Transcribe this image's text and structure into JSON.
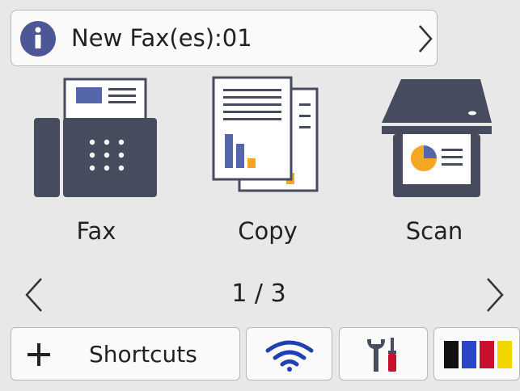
{
  "notification": {
    "message": "New Fax(es):01",
    "icon": "info-icon",
    "chevron": "chevron-right-icon"
  },
  "tiles": [
    {
      "id": "fax",
      "label": "Fax",
      "icon": "fax-machine-icon"
    },
    {
      "id": "copy",
      "label": "Copy",
      "icon": "copy-documents-icon"
    },
    {
      "id": "scan",
      "label": "Scan",
      "icon": "scanner-icon"
    }
  ],
  "pager": {
    "indicator": "1 / 3",
    "prev_icon": "chevron-left-icon",
    "next_icon": "chevron-right-icon"
  },
  "bottom_bar": {
    "shortcuts_label": "Shortcuts",
    "shortcuts_icon": "plus-icon",
    "wifi_icon": "wifi-icon",
    "settings_icon": "settings-tools-icon",
    "ink_icon": "ink-levels-icon"
  },
  "colors": {
    "background": "#e8e8e8",
    "icon_dark": "#474b5e",
    "accent_blue": "#5566aa",
    "accent_orange": "#f5a623",
    "info_blue": "#4d5696",
    "ink_black": "#111111",
    "ink_cyan": "#2b46c8",
    "ink_magenta": "#c8102e",
    "ink_yellow": "#f2d600"
  }
}
